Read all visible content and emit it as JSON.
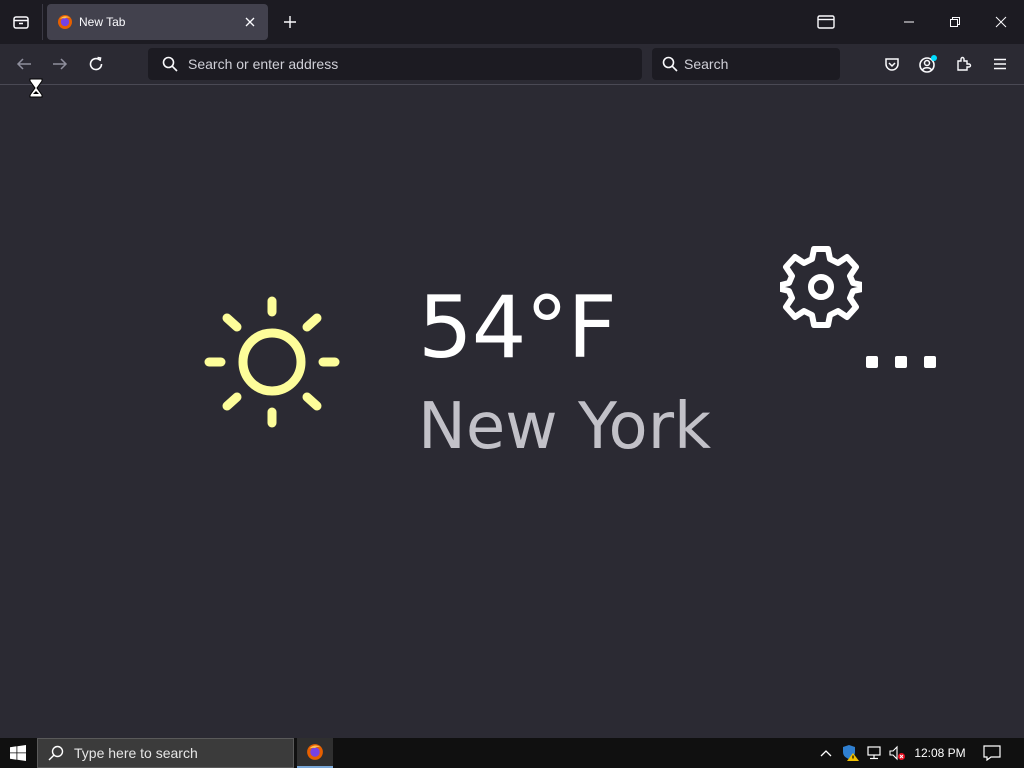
{
  "browser": {
    "tab": {
      "title": "New Tab"
    },
    "urlbar": {
      "placeholder": "Search or enter address"
    },
    "searchbar": {
      "placeholder": "Search"
    }
  },
  "weather": {
    "temperature": "54°F",
    "city": "New York",
    "sun_color": "#fdfd9a"
  },
  "taskbar": {
    "search_placeholder": "Type here to search",
    "clock": "12:08 PM"
  },
  "icons": {
    "tab_list": "tab-list-icon",
    "favicon": "firefox-icon",
    "close_tab": "close-icon",
    "new_tab": "plus-icon",
    "back": "back-arrow-icon",
    "forward": "forward-arrow-icon",
    "reload": "reload-icon",
    "pocket": "pocket-icon",
    "account": "account-icon",
    "extensions": "extensions-icon",
    "menu": "hamburger-menu-icon"
  }
}
